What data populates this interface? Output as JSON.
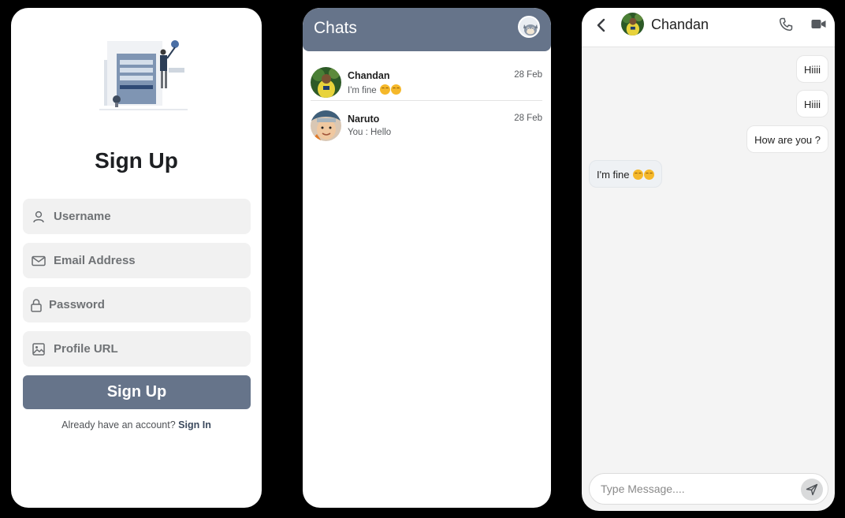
{
  "signup": {
    "title": "Sign Up",
    "fields": {
      "username_placeholder": "Username",
      "email_placeholder": "Email Address",
      "password_placeholder": "Password",
      "profile_placeholder": "Profile URL"
    },
    "button_label": "Sign Up",
    "signin_prompt": "Already have an account?",
    "signin_link": "Sign In",
    "accent_color": "#66748a"
  },
  "chats": {
    "title": "Chats",
    "items": [
      {
        "name": "Chandan",
        "message": "I'm fine",
        "date": "28 Feb",
        "emoji": "😳😳"
      },
      {
        "name": "Naruto",
        "message": "You : Hello",
        "date": "28 Feb"
      }
    ]
  },
  "conversation": {
    "contact_name": "Chandan",
    "messages": [
      {
        "text": "Hiiii",
        "direction": "outgoing"
      },
      {
        "text": "Hiiii",
        "direction": "outgoing"
      },
      {
        "text": "How are you ?",
        "direction": "outgoing"
      },
      {
        "text": "I'm fine",
        "direction": "incoming",
        "emoji": "😳😳"
      }
    ],
    "composer_placeholder": "Type Message....",
    "icons": [
      "back-arrow-icon",
      "phone-icon",
      "video-camera-icon",
      "send-icon"
    ]
  }
}
